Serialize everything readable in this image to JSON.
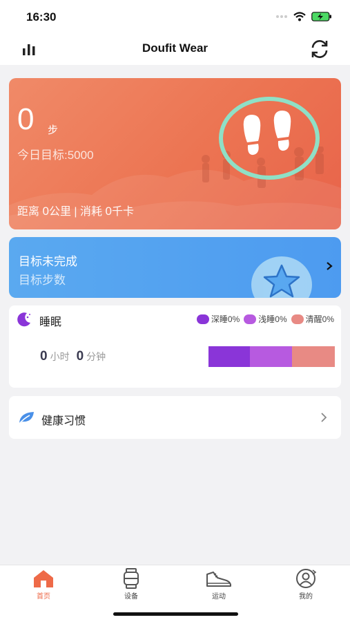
{
  "status_bar": {
    "time": "16:30"
  },
  "navbar": {
    "title": "Doufit Wear"
  },
  "steps": {
    "count": "0",
    "unit": "步",
    "goal_text": "今日目标:5000",
    "distance_label": "距离",
    "distance_value": "0",
    "distance_unit": "公里",
    "separator": "|",
    "calories_label": "消耗",
    "calories_value": "0",
    "calories_unit": "千卡"
  },
  "goal": {
    "title": "目标未完成",
    "subtitle": "目标步数"
  },
  "sleep": {
    "title": "睡眠",
    "legend": [
      {
        "label": "深睡0%",
        "color": "#8a35d8"
      },
      {
        "label": "浅睡0%",
        "color": "#b75ae0"
      },
      {
        "label": "清醒0%",
        "color": "#e88a84"
      }
    ],
    "hours": "0",
    "hours_unit": "小时",
    "minutes": "0",
    "minutes_unit": "分钟"
  },
  "habit": {
    "label": "健康习惯"
  },
  "tabs": [
    {
      "label": "首页",
      "icon": "home-icon",
      "active": true
    },
    {
      "label": "设备",
      "icon": "watch-icon",
      "active": false
    },
    {
      "label": "运动",
      "icon": "shoe-icon",
      "active": false
    },
    {
      "label": "我的",
      "icon": "profile-icon",
      "active": false
    }
  ],
  "colors": {
    "accent": "#ee6a48",
    "steps_card": "#ec7452",
    "goal_card": "#4d9bf0"
  }
}
